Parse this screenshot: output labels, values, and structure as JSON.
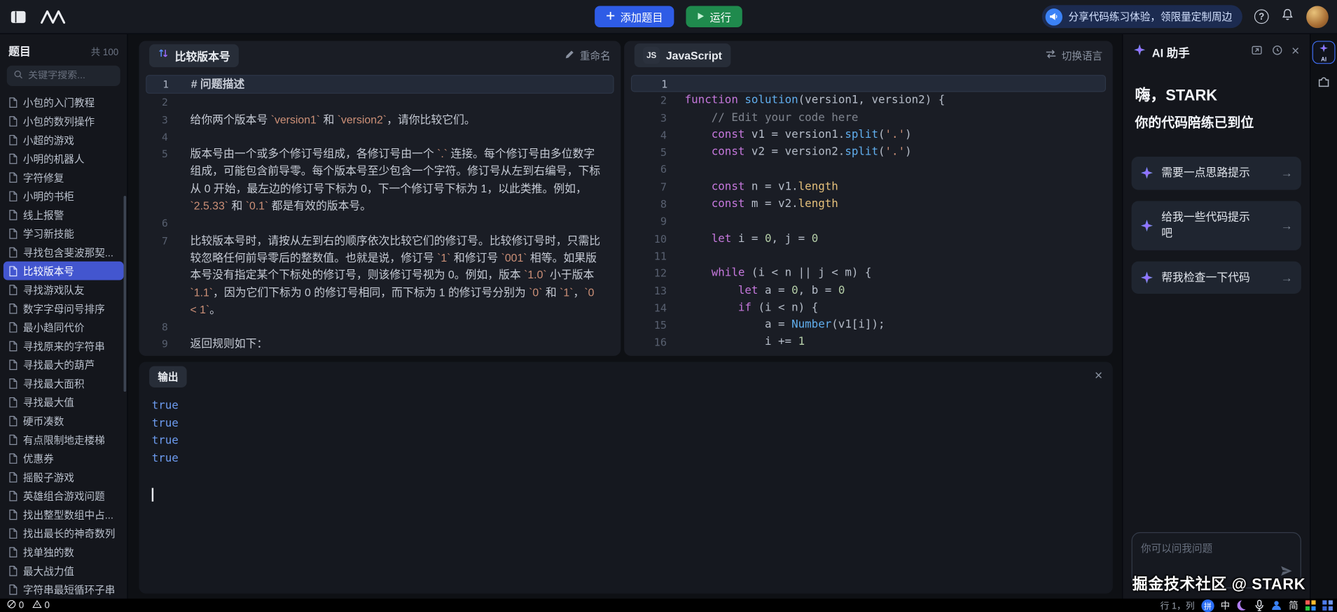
{
  "topbar": {
    "add_button": "添加题目",
    "run_button": "运行",
    "promo_text": "分享代码练习体验，领限量定制周边"
  },
  "sidebar": {
    "title": "题目",
    "count": "共 100",
    "search_placeholder": "关键字搜索...",
    "selected_index": 9,
    "items": [
      "小包的入门教程",
      "小包的数列操作",
      "小超的游戏",
      "小明的机器人",
      "字符修复",
      "小明的书柜",
      "线上报警",
      "学习新技能",
      "寻找包含斐波那契...",
      "比较版本号",
      "寻找游戏队友",
      "数字字母问号排序",
      "最小趋同代价",
      "寻找原来的字符串",
      "寻找最大的葫芦",
      "寻找最大面积",
      "寻找最大值",
      "硬币凑数",
      "有点限制地走楼梯",
      "优惠券",
      "摇骰子游戏",
      "英雄组合游戏问题",
      "找出整型数组中占...",
      "找出最长的神奇数列",
      "找单独的数",
      "最大战力值",
      "字符串最短循环子串"
    ]
  },
  "problem": {
    "title": "比较版本号",
    "rename_label": "重命名",
    "lines": [
      {
        "n": "1",
        "text": "# 问题描述",
        "heading": true,
        "current": true
      },
      {
        "n": "2",
        "text": ""
      },
      {
        "n": "3",
        "text": "给你两个版本号 `version1` 和 `version2`，请你比较它们。"
      },
      {
        "n": "4",
        "text": ""
      },
      {
        "n": "5",
        "text": "版本号由一个或多个修订号组成，各修订号由一个 `.` 连接。每个修订号由多位数字组成，可能包含前导零。每个版本号至少包含一个字符。修订号从左到右编号，下标从 0 开始，最左边的修订号下标为 0，下一个修订号下标为 1，以此类推。例如，`2.5.33` 和 `0.1` 都是有效的版本号。"
      },
      {
        "n": "6",
        "text": ""
      },
      {
        "n": "7",
        "text": "比较版本号时，请按从左到右的顺序依次比较它们的修订号。比较修订号时，只需比较忽略任何前导零后的整数值。也就是说，修订号 `1` 和修订号 `001` 相等。如果版本号没有指定某个下标处的修订号，则该修订号视为 0。例如，版本 `1.0` 小于版本 `1.1`，因为它们下标为 0 的修订号相同，而下标为 1 的修订号分别为 `0` 和 `1`，`0 < 1`。"
      },
      {
        "n": "8",
        "text": ""
      },
      {
        "n": "9",
        "text": "返回规则如下："
      }
    ]
  },
  "editor": {
    "language_badge": "JS",
    "language": "JavaScript",
    "switch_label": "切换语言",
    "code_lines": [
      "",
      "function solution(version1, version2) {",
      "    // Edit your code here",
      "    const v1 = version1.split('.')",
      "    const v2 = version2.split('.')",
      "",
      "    const n = v1.length",
      "    const m = v2.length",
      "",
      "    let i = 0, j = 0",
      "",
      "    while (i < n || j < m) {",
      "        let a = 0, b = 0",
      "        if (i < n) {",
      "            a = Number(v1[i]);",
      "            i += 1"
    ]
  },
  "output": {
    "title": "输出",
    "lines": [
      "true",
      "true",
      "true",
      "true"
    ]
  },
  "ai": {
    "title": "AI 助手",
    "tool_label": "AI",
    "greeting_line1": "嗨，STARK",
    "greeting_line2": "你的代码陪练已到位",
    "suggestions": [
      "需要一点思路提示",
      "给我一些代码提示吧",
      "帮我检查一下代码"
    ],
    "input_placeholder": "你可以问我问题"
  },
  "watermark": "掘金技术社区 @ STARK",
  "statusbar": {
    "error_count": "0",
    "warning_count": "0",
    "cursor_position": "行 1，列",
    "tray": [
      {
        "type": "badge",
        "label": "拼",
        "color": "#2a6df4",
        "name": "ime-pinyin-icon"
      },
      {
        "type": "text",
        "label": "中",
        "name": "ime-lang-icon"
      },
      {
        "type": "moon",
        "name": "night-mode-icon"
      },
      {
        "type": "mic",
        "name": "mic-icon"
      },
      {
        "type": "person",
        "name": "account-icon"
      },
      {
        "type": "text",
        "label": "简",
        "name": "simplified-chinese-icon"
      },
      {
        "type": "grid",
        "name": "app-grid-icon"
      },
      {
        "type": "grid-blue",
        "name": "launcher-grid-icon"
      }
    ]
  },
  "colors": {
    "accent_blue": "#2e5ce6",
    "run_green": "#1f8a4d",
    "selected_item": "#4356cf",
    "output_value": "#6d9cf1",
    "heading_blue": "#6b9ef7"
  }
}
